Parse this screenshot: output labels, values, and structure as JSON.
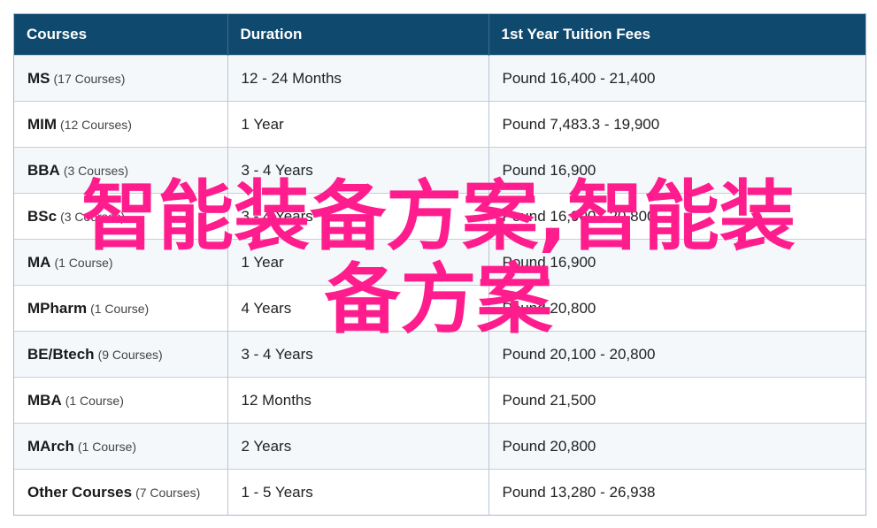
{
  "table": {
    "headers": [
      "Courses",
      "Duration",
      "1st Year Tuition Fees"
    ],
    "rows": [
      {
        "name": "MS",
        "count": "(17 Courses)",
        "duration": "12 - 24 Months",
        "fees": "Pound 16,400 - 21,400"
      },
      {
        "name": "MIM",
        "count": "(12 Courses)",
        "duration": "1 Year",
        "fees": "Pound 7,483.3 - 19,900"
      },
      {
        "name": "BBA",
        "count": "(3 Courses)",
        "duration": "3 - 4 Years",
        "fees": "Pound 16,900"
      },
      {
        "name": "BSc",
        "count": "(3 Courses)",
        "duration": "3 - 4 Years",
        "fees": "Pound 16,900 - 20,800"
      },
      {
        "name": "MA",
        "count": "(1 Course)",
        "duration": "1 Year",
        "fees": "Pound 16,900"
      },
      {
        "name": "MPharm",
        "count": "(1 Course)",
        "duration": "4 Years",
        "fees": "Pound 20,800"
      },
      {
        "name": "BE/Btech",
        "count": "(9 Courses)",
        "duration": "3 - 4 Years",
        "fees": "Pound 20,100 - 20,800"
      },
      {
        "name": "MBA",
        "count": "(1 Course)",
        "duration": "12 Months",
        "fees": "Pound 21,500"
      },
      {
        "name": "MArch",
        "count": "(1 Course)",
        "duration": "2 Years",
        "fees": "Pound 20,800"
      },
      {
        "name": "Other Courses",
        "count": "(7 Courses)",
        "duration": "1 - 5 Years",
        "fees": "Pound 13,280 - 26,938"
      }
    ]
  },
  "watermark": {
    "line1": "智能装备方案,智能装",
    "line2": "备方案",
    "color": "#ff1d8e"
  },
  "colors": {
    "header_bg": "#0f4a6e",
    "row_alt_bg": "#f4f8fb"
  }
}
